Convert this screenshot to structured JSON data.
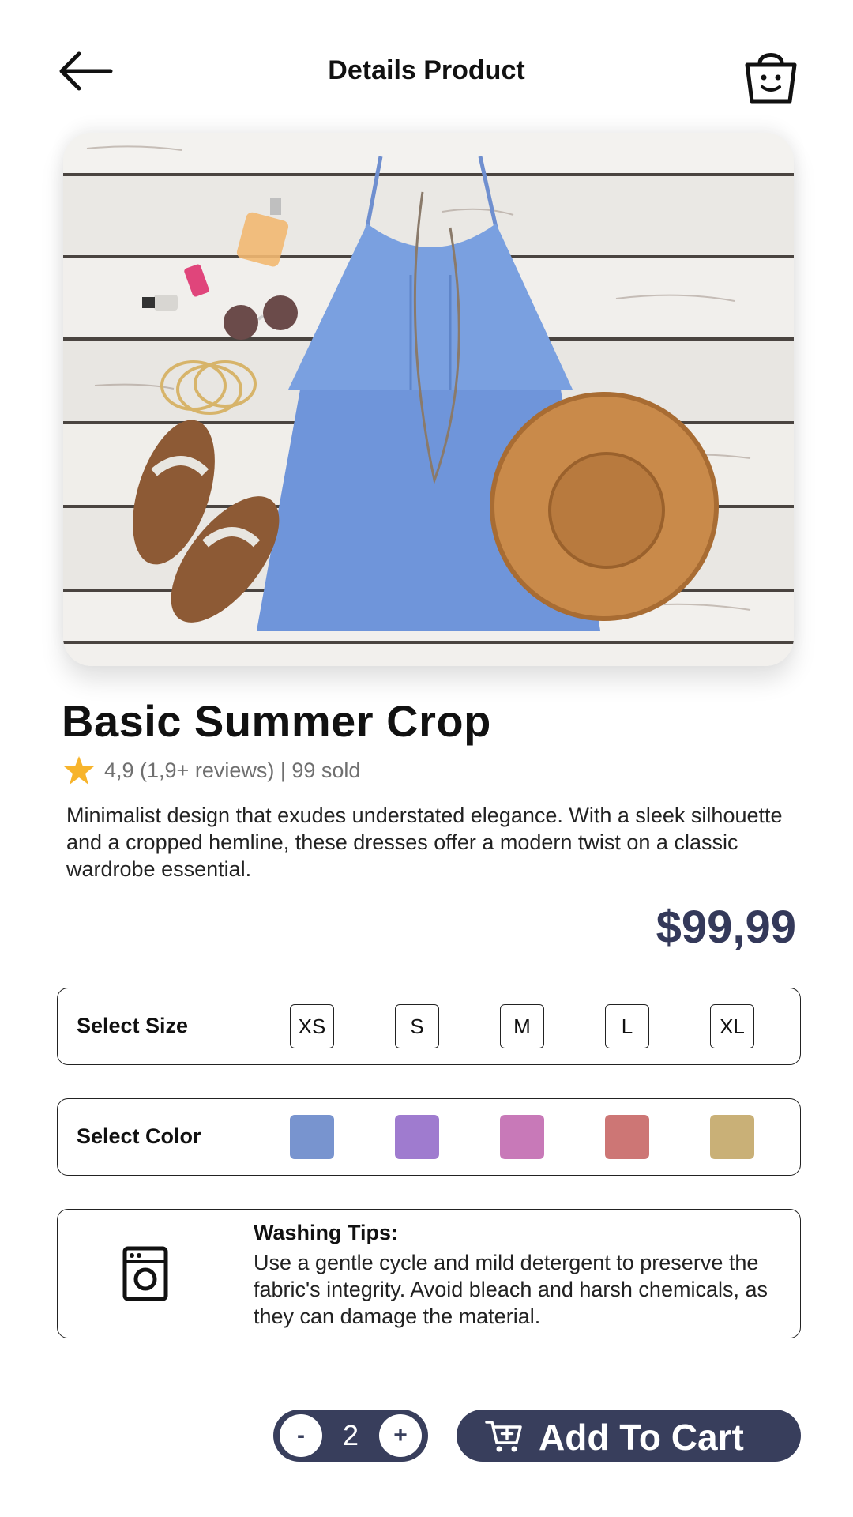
{
  "header": {
    "title": "Details Product",
    "back_icon": "arrow-left-icon",
    "cart_icon": "basket-icon"
  },
  "product": {
    "title": "Basic Summer Crop",
    "rating_icon": "star-icon",
    "rating": "4,9 (1,9+ reviews) | 99 sold",
    "description": "Minimalist design that exudes understated elegance. With a sleek silhouette and a cropped hemline, these dresses offer a modern twist on a classic wardrobe essential.",
    "price": "$99,99"
  },
  "size": {
    "label": "Select Size",
    "options": [
      "XS",
      "S",
      "M",
      "L",
      "XL"
    ]
  },
  "color": {
    "label": "Select Color",
    "swatches": [
      "#7894cf",
      "#9f7bcf",
      "#c879b8",
      "#cd7675",
      "#c9b077"
    ]
  },
  "washing": {
    "icon": "washing-machine-icon",
    "title": "Washing Tips:",
    "text": "Use a gentle cycle and mild detergent to preserve the fabric's integrity. Avoid bleach and harsh chemicals, as they can damage the material."
  },
  "cart": {
    "quantity": "2",
    "minus_label": "-",
    "plus_label": "+",
    "add_label": "Add To Cart",
    "icon": "cart-add-icon"
  },
  "colors": {
    "accent": "#383e5c",
    "price": "#34395a"
  }
}
